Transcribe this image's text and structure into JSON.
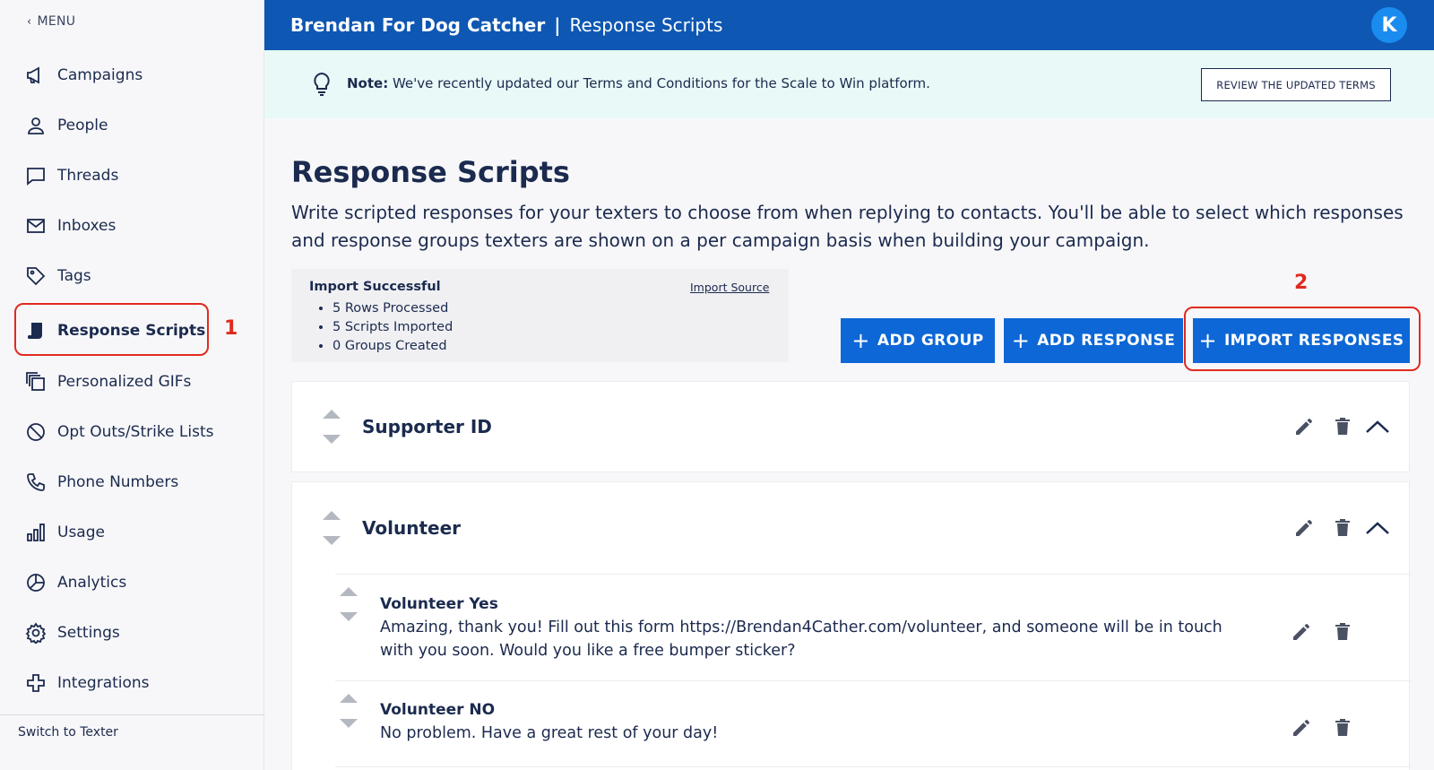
{
  "sidebar": {
    "back_label": "MENU",
    "items": [
      {
        "label": "Campaigns",
        "icon": "megaphone-icon"
      },
      {
        "label": "People",
        "icon": "person-icon"
      },
      {
        "label": "Threads",
        "icon": "chat-icon"
      },
      {
        "label": "Inboxes",
        "icon": "envelope-icon"
      },
      {
        "label": "Tags",
        "icon": "tag-icon"
      },
      {
        "label": "Response Scripts",
        "icon": "script-icon",
        "active": true
      },
      {
        "label": "Personalized GIFs",
        "icon": "gif-stack-icon"
      },
      {
        "label": "Opt Outs/Strike Lists",
        "icon": "block-icon"
      },
      {
        "label": "Phone Numbers",
        "icon": "phone-icon"
      },
      {
        "label": "Usage",
        "icon": "bar-chart-icon"
      },
      {
        "label": "Analytics",
        "icon": "pie-chart-icon"
      },
      {
        "label": "Settings",
        "icon": "gear-icon"
      },
      {
        "label": "Integrations",
        "icon": "puzzle-icon"
      }
    ],
    "switch_label": "Switch to Texter"
  },
  "annotations": {
    "one": "1",
    "two": "2"
  },
  "header": {
    "org": "Brendan For Dog Catcher",
    "separator": "|",
    "section": "Response Scripts",
    "avatar_initial": "K"
  },
  "note": {
    "label": "Note:",
    "text": "We've recently updated our Terms and Conditions for the Scale to Win platform.",
    "button": "REVIEW THE UPDATED TERMS"
  },
  "main": {
    "title": "Response Scripts",
    "description": "Write scripted responses for your texters to choose from when replying to contacts. You'll be able to select which responses and response groups texters are shown on a per campaign basis when building your campaign.",
    "import": {
      "title": "Import Successful",
      "source_link": "Import Source",
      "results": [
        "5 Rows Processed",
        "5 Scripts Imported",
        "0 Groups Created"
      ]
    },
    "buttons": {
      "add_group": "ADD GROUP",
      "add_response": "ADD RESPONSE",
      "import_responses": "IMPORT RESPONSES"
    },
    "groups": [
      {
        "name": "Supporter ID"
      },
      {
        "name": "Volunteer",
        "responses": [
          {
            "title": "Volunteer Yes",
            "body": "Amazing, thank you! Fill out this form https://Brendan4Cather.com/volunteer, and someone will be in touch with you soon. Would you like a free bumper sticker?"
          },
          {
            "title": "Volunteer NO",
            "body": "No problem. Have a great rest of your day!"
          }
        ]
      }
    ]
  },
  "colors": {
    "header_blue": "#0e57b3",
    "button_blue": "#0d67d6",
    "annotation_red": "#e02a1f",
    "note_bg": "#e9f9f7"
  }
}
